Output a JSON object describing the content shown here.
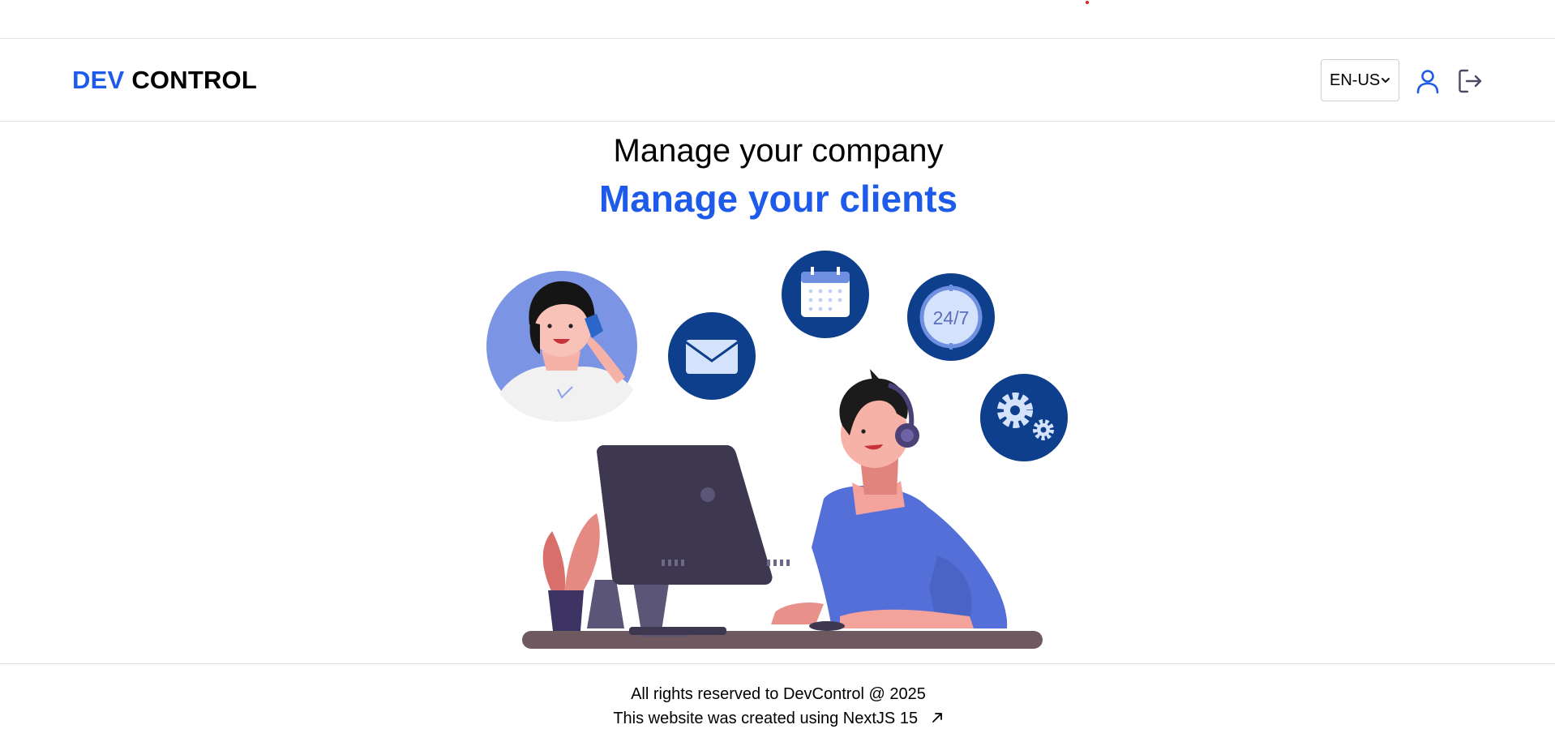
{
  "header": {
    "logo_part1": "DEV",
    "logo_part2": "CONTROL",
    "language": "EN-US",
    "icons": [
      "user-icon",
      "logout-icon",
      "chevron-down-icon"
    ]
  },
  "hero": {
    "title": "Manage your company",
    "subtitle": "Manage your clients",
    "illustration_badge": "24/7",
    "illustration_icons": [
      "mail-icon",
      "calendar-icon",
      "clock-24-7-icon",
      "gears-icon"
    ]
  },
  "footer": {
    "rights": "All rights reserved to DevControl @ 2025",
    "created_with": "This website was created using NextJS 15",
    "icons": [
      "external-link-arrow-icon"
    ]
  },
  "colors": {
    "brand_blue": "#1f5bea",
    "dark_navy": "#0d3f8c",
    "monitor": "#3d374f",
    "shirt": "#5470d8"
  }
}
